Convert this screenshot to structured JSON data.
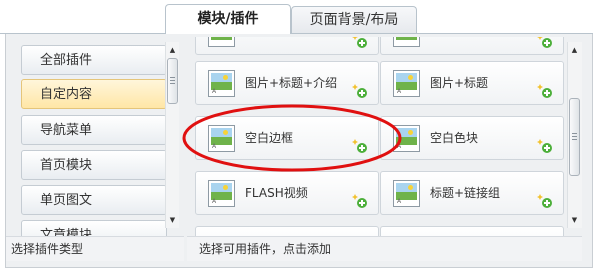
{
  "tabs": [
    {
      "label": "模块/插件",
      "active": true
    },
    {
      "label": "页面背景/布局",
      "active": false
    }
  ],
  "left_panel": {
    "categories": [
      {
        "label": "全部插件",
        "selected": false
      },
      {
        "label": "自定内容",
        "selected": true
      },
      {
        "label": "导航菜单",
        "selected": false
      },
      {
        "label": "首页模块",
        "selected": false
      },
      {
        "label": "单页图文",
        "selected": false
      },
      {
        "label": "文章模块",
        "selected": false
      }
    ],
    "status": "选择插件类型"
  },
  "plugin_grid": {
    "plugins": [
      {
        "label": ""
      },
      {
        "label": ""
      },
      {
        "label": "图片+标题+介绍"
      },
      {
        "label": "图片+标题"
      },
      {
        "label": "空白边框"
      },
      {
        "label": "空白色块"
      },
      {
        "label": "FLASH视频"
      },
      {
        "label": "标题+链接组"
      }
    ],
    "status": "选择可用插件，点击添加"
  },
  "colors": {
    "highlight_ring": "#e01010",
    "selected_bg": "#ffe6a6",
    "add_icon": "#4caf3a"
  }
}
